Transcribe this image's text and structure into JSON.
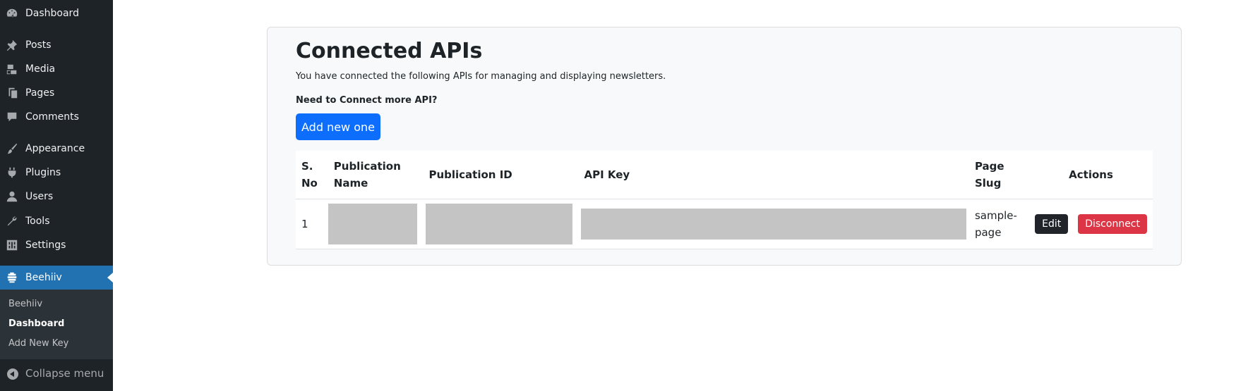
{
  "sidebar": {
    "items": [
      {
        "label": "Dashboard",
        "icon": "dashboard-icon"
      },
      {
        "label": "Posts",
        "icon": "pin-icon"
      },
      {
        "label": "Media",
        "icon": "media-icon"
      },
      {
        "label": "Pages",
        "icon": "pages-icon"
      },
      {
        "label": "Comments",
        "icon": "comment-icon"
      },
      {
        "label": "Appearance",
        "icon": "brush-icon"
      },
      {
        "label": "Plugins",
        "icon": "plugin-icon"
      },
      {
        "label": "Users",
        "icon": "user-icon"
      },
      {
        "label": "Tools",
        "icon": "wrench-icon"
      },
      {
        "label": "Settings",
        "icon": "settings-icon"
      },
      {
        "label": "Beehiiv",
        "icon": "beehive-icon",
        "current": true
      }
    ],
    "submenu": [
      "Beehiiv",
      "Dashboard",
      "Add New Key"
    ],
    "submenu_active": "Dashboard",
    "collapse_label": "Collapse menu"
  },
  "main": {
    "title": "Connected APIs",
    "subtitle": "You have connected the following APIs for managing and displaying newsletters.",
    "connect_heading": "Need to Connect more API?",
    "add_button": "Add new one",
    "table": {
      "headers": [
        "S. No",
        "Publication Name",
        "Publication ID",
        "API Key",
        "Page Slug",
        "Actions"
      ],
      "rows": [
        {
          "sno": "1",
          "page_slug": "sample-page",
          "edit_label": "Edit",
          "disconnect_label": "Disconnect"
        }
      ]
    }
  },
  "colors": {
    "sidebar_bg": "#1d2327",
    "current_menu": "#2271b1",
    "primary_button": "#0d6efd",
    "danger_button": "#dc3545",
    "dark_button": "#212529",
    "redaction": "#c4c4c4"
  }
}
